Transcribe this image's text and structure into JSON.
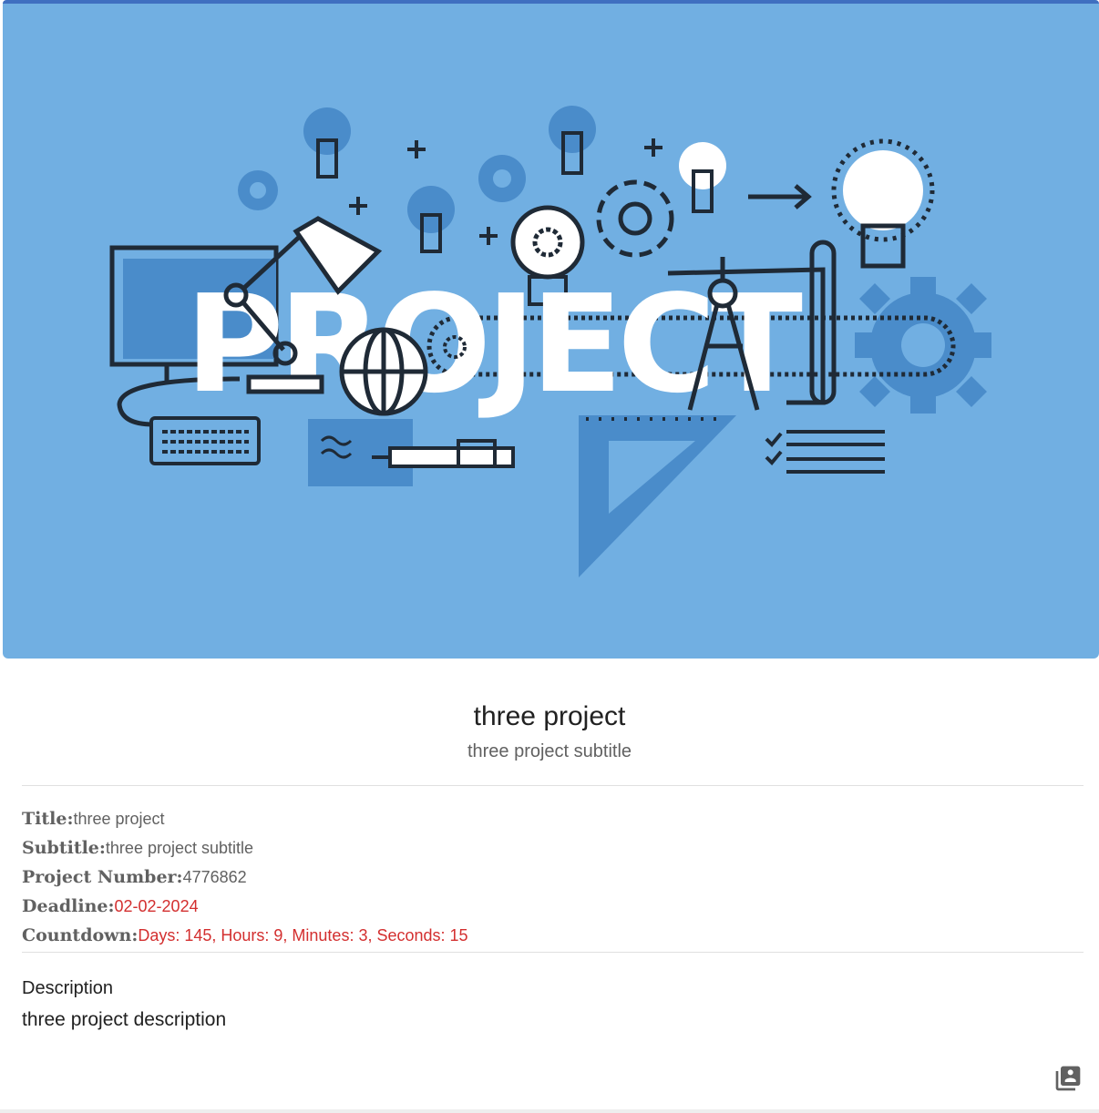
{
  "hero": {
    "banner_word": "PROJECT",
    "background_color": "#71afe2",
    "accent_color": "#4a8cca",
    "icons": [
      "lightbulb-icon",
      "gear-icon",
      "monitor-icon",
      "desk-lamp-icon",
      "keyboard-icon",
      "globe-icon",
      "compass-icon",
      "pen-icon",
      "triangle-ruler-icon",
      "checklist-icon",
      "arrow-right-icon",
      "plus-icon"
    ]
  },
  "project": {
    "title": "three project",
    "subtitle": "three project subtitle"
  },
  "details": {
    "title_label": "Title:",
    "title_value": "three project",
    "subtitle_label": "Subtitle:",
    "subtitle_value": "three project subtitle",
    "number_label": "Project Number:",
    "number_value": "4776862",
    "deadline_label": "Deadline:",
    "deadline_value": "02-02-2024",
    "countdown_label": "Countdown:",
    "countdown_value": "Days: 145, Hours: 9, Minutes: 3, Seconds: 15",
    "highlight_color": "#d32f2f"
  },
  "description": {
    "heading": "Description",
    "text": "three project description"
  },
  "actions": {
    "corner_icon": "account-box-multiple-icon"
  }
}
